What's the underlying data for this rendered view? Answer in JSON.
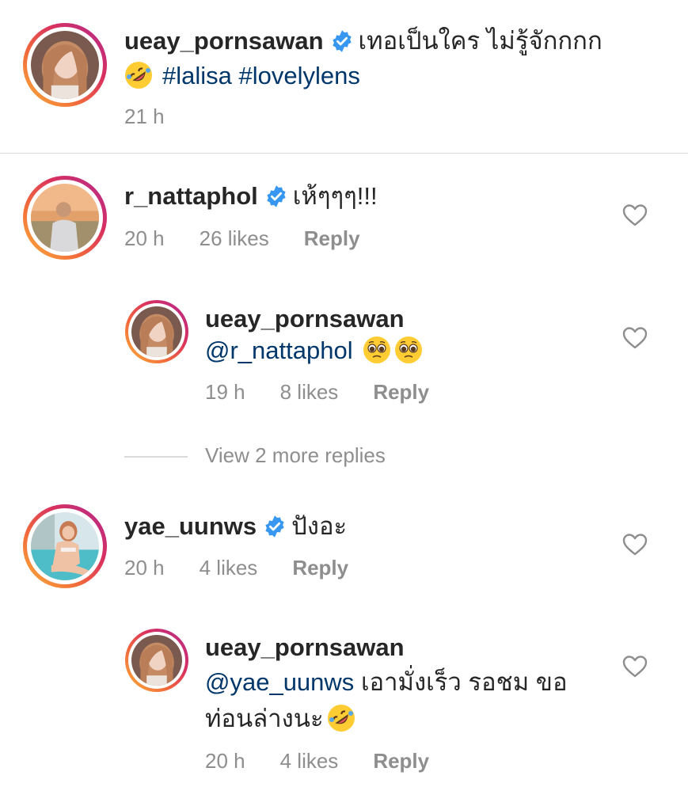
{
  "post_caption": {
    "username": "ueay_pornsawan",
    "text": "เทอเป็นใคร ไม่รู้จักกกก",
    "hashtags": "#lalisa #lovelylens",
    "time": "21 h"
  },
  "comments": [
    {
      "username": "r_nattaphol",
      "text": "เห้ๆๆๆ!!!",
      "time": "20 h",
      "likes": "26 likes",
      "reply_label": "Reply",
      "replies": [
        {
          "username": "ueay_pornsawan",
          "mention": "@r_nattaphol",
          "time": "19 h",
          "likes": "8 likes",
          "reply_label": "Reply"
        }
      ],
      "view_more": "View 2 more replies"
    },
    {
      "username": "yae_uunws",
      "text": "ปังอะ",
      "time": "20 h",
      "likes": "4 likes",
      "reply_label": "Reply",
      "replies": [
        {
          "username": "ueay_pornsawan",
          "mention": "@yae_uunws",
          "text_line1": "เอามั่งเร็ว รอชม ขอ",
          "text_line2": "ท่อนล่างนะ",
          "time": "20 h",
          "likes": "4 likes",
          "reply_label": "Reply"
        }
      ]
    }
  ],
  "icons": {
    "verified": "verified-badge-icon",
    "like": "heart-outline-icon",
    "laugh_emoji": "rolling-on-floor-laughing-emoji",
    "pleading_emoji": "pleading-face-emoji"
  },
  "colors": {
    "verified_blue": "#3897f0",
    "link_blue": "#00376b",
    "muted_gray": "#8e8e8e",
    "ring_gradient_start": "#f9b33a",
    "ring_gradient_end": "#b12a8f"
  }
}
